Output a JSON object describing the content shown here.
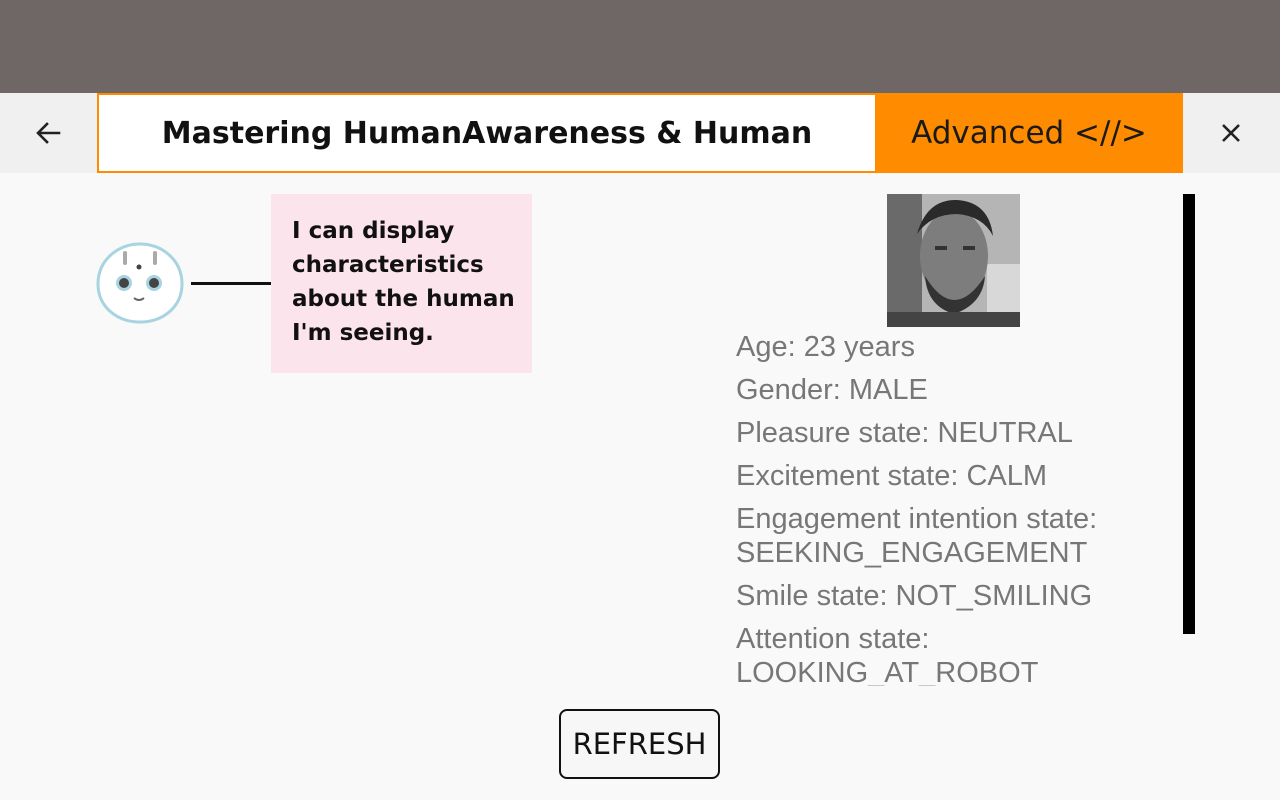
{
  "header": {
    "back_icon": "arrow-left-icon",
    "title": "Mastering HumanAwareness & Human",
    "advanced_tab": "Advanced <//>",
    "close_icon": "close-icon",
    "accent_color": "#ff8c00"
  },
  "robot": {
    "icon": "robot-head-icon",
    "message": "I can display characteristics about the human I'm seeing."
  },
  "human": {
    "photo_icon": "human-face-photo",
    "characteristics": [
      "Age: 23 years",
      "Gender: MALE",
      "Pleasure state: NEUTRAL",
      "Excitement state: CALM",
      "Engagement intention state: SEEKING_ENGAGEMENT",
      "Smile state: NOT_SMILING",
      "Attention state: LOOKING_AT_ROBOT"
    ]
  },
  "actions": {
    "refresh_label": "REFRESH"
  }
}
